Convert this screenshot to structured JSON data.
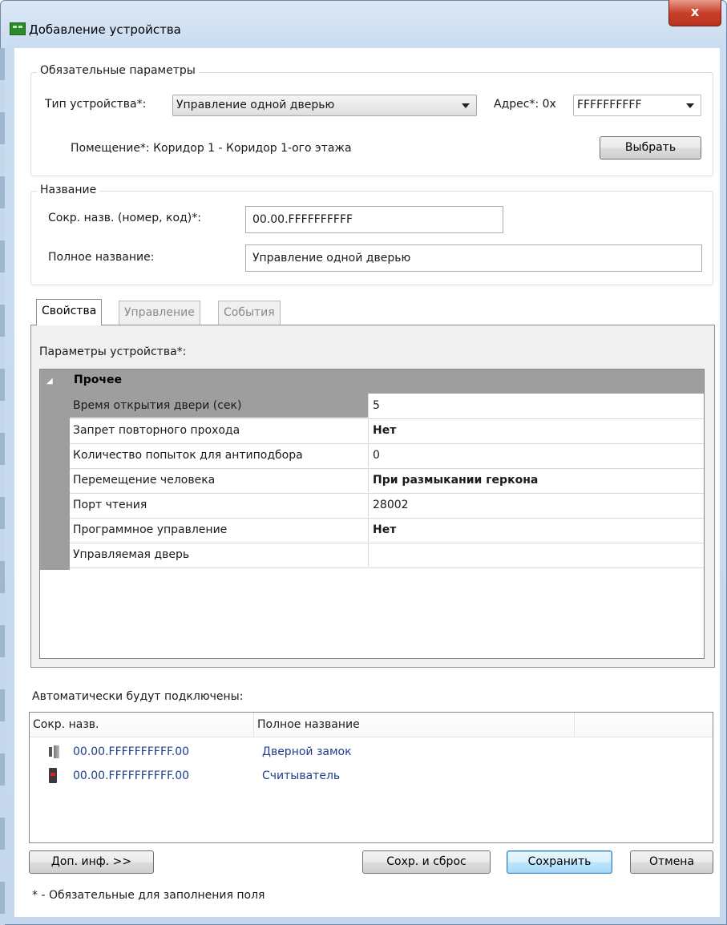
{
  "window": {
    "title": "Добавление устройства",
    "close_glyph": "x"
  },
  "required": {
    "group_title": "Обязательные параметры",
    "device_type_label": "Тип устройства*:",
    "device_type_value": "Управление одной дверью",
    "address_label": "Адрес*: 0x",
    "address_value": "FFFFFFFFFF",
    "room_label": "Помещение*: Коридор 1 - Коридор 1-ого этажа",
    "choose_button": "Выбрать"
  },
  "name": {
    "group_title": "Название",
    "short_label": "Сокр. назв. (номер, код)*:",
    "short_value": "00.00.FFFFFFFFFF",
    "full_label": "Полное название:",
    "full_value": "Управление одной дверью"
  },
  "tabs": [
    {
      "label": "Свойства",
      "active": true
    },
    {
      "label": "Управление",
      "active": false
    },
    {
      "label": "События",
      "active": false
    }
  ],
  "properties": {
    "label": "Параметры устройства*:",
    "category": "Прочее",
    "rows": [
      {
        "name": "Время открытия двери (сек)",
        "value": "5"
      },
      {
        "name": "Запрет повторного прохода",
        "value": "Нет"
      },
      {
        "name": "Количество попыток для антиподбора",
        "value": "0"
      },
      {
        "name": "Перемещение человека",
        "value": "При размыкании геркона"
      },
      {
        "name": "Порт чтения",
        "value": "28002"
      },
      {
        "name": "Программное управление",
        "value": "Нет"
      },
      {
        "name": "Управляемая дверь",
        "value": ""
      }
    ]
  },
  "auto": {
    "label": "Автоматически будут подключены:",
    "columns": [
      "Сокр. назв.",
      "Полное название"
    ],
    "items": [
      {
        "icon": "door-lock-icon",
        "short": "00.00.FFFFFFFFFF.00",
        "full": "Дверной замок"
      },
      {
        "icon": "card-reader-icon",
        "short": "00.00.FFFFFFFFFF.00",
        "full": "Считыватель"
      }
    ]
  },
  "buttons": {
    "more_info": "Доп. инф. >>",
    "save_reset": "Сохр. и сброс",
    "save": "Сохранить",
    "cancel": "Отмена"
  },
  "footnote": "* - Обязательные для заполнения поля"
}
